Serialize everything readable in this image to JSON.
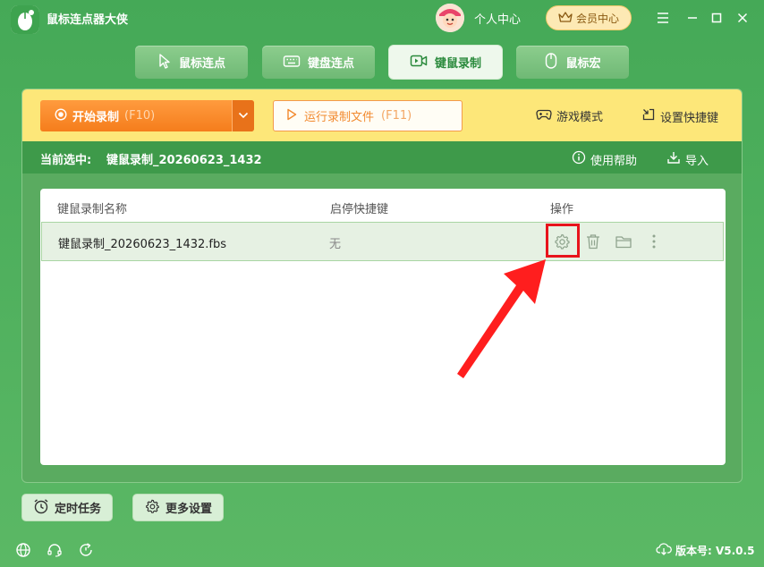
{
  "app": {
    "title": "鼠标连点器大侠"
  },
  "header": {
    "user_center": "个人中心",
    "vip": "会员中心"
  },
  "tabs": [
    {
      "label": "鼠标连点"
    },
    {
      "label": "键盘连点"
    },
    {
      "label": "键鼠录制"
    },
    {
      "label": "鼠标宏"
    }
  ],
  "toolbar": {
    "record_label": "开始录制",
    "record_hotkey": "(F10)",
    "run_label": "运行录制文件",
    "run_hotkey": "(F11)",
    "game_mode": "游戏模式",
    "set_hotkey": "设置快捷键"
  },
  "selection": {
    "label": "当前选中:",
    "value": "键鼠录制_20260623_1432",
    "help": "使用帮助",
    "import": "导入"
  },
  "table": {
    "headers": [
      "键鼠录制名称",
      "启停快捷键",
      "操作"
    ],
    "rows": [
      {
        "name": "键鼠录制_20260623_1432.fbs",
        "hotkey": "无"
      }
    ]
  },
  "bottom": {
    "timer": "定时任务",
    "more_settings": "更多设置"
  },
  "footer": {
    "version": "版本号: V5.0.5"
  },
  "colors": {
    "accent": "#3e9a4a",
    "orange": "#f57d1c",
    "highlight": "#e8141c"
  }
}
